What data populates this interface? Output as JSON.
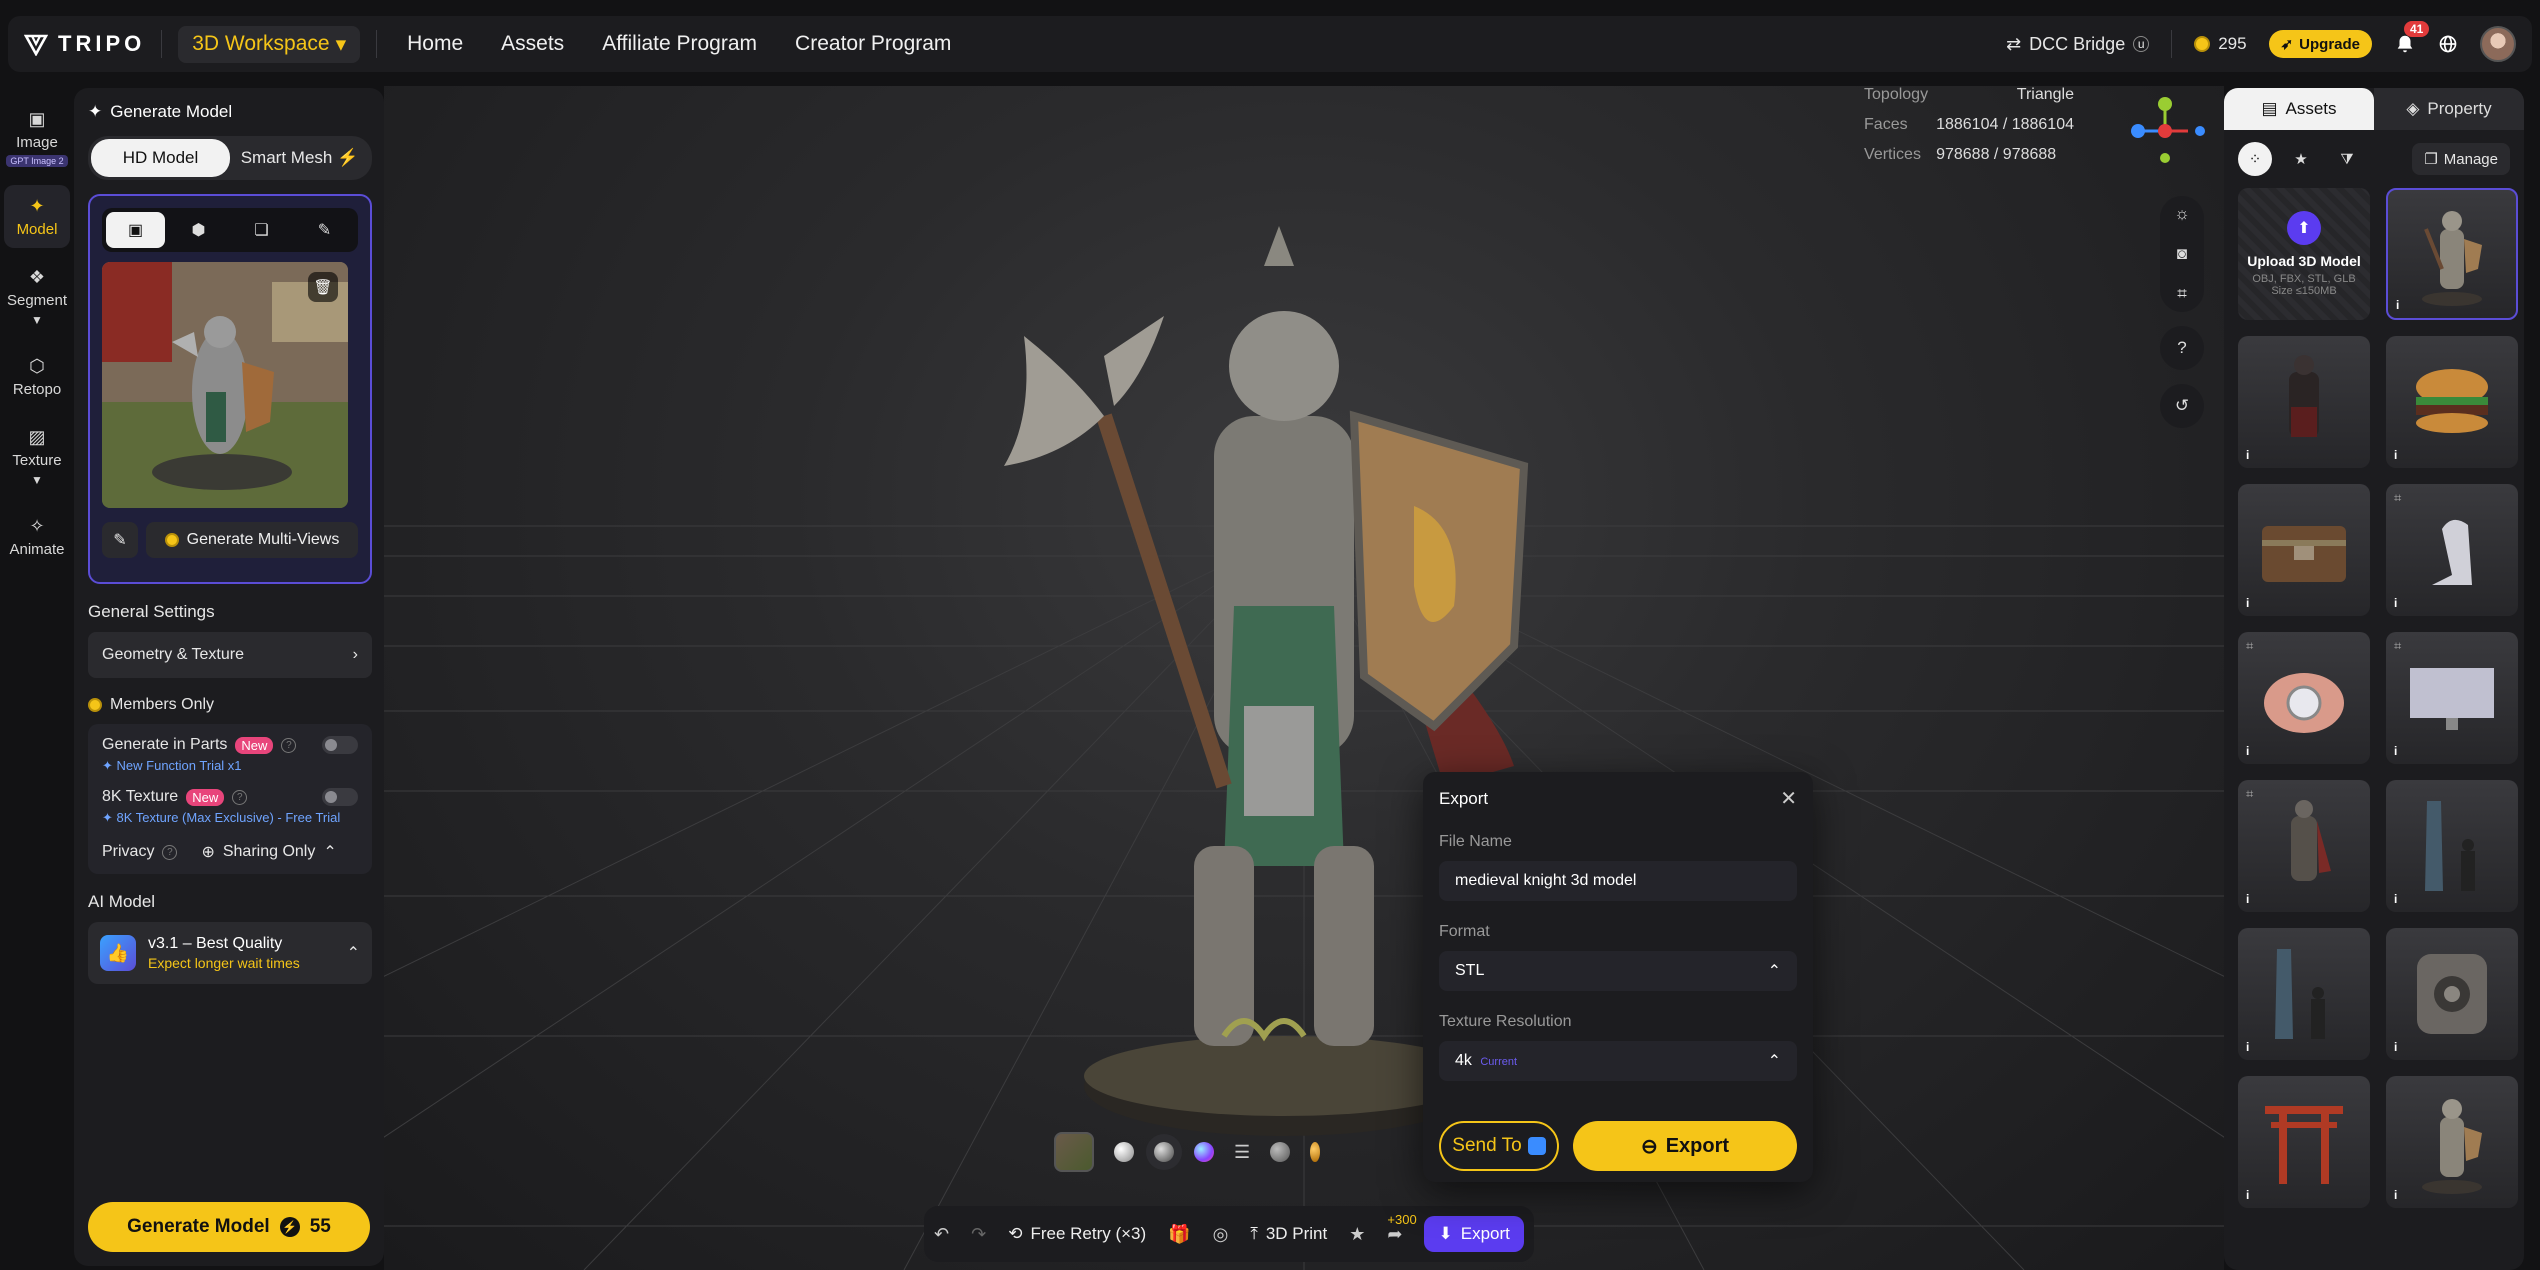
{
  "header": {
    "logo": "TRIPO",
    "workspace": "3D Workspace",
    "nav": [
      "Home",
      "Assets",
      "Affiliate Program",
      "Creator Program"
    ],
    "dcc": "DCC Bridge",
    "credits": "295",
    "upgrade": "Upgrade",
    "notifications": "41"
  },
  "rail": {
    "items": [
      {
        "label": "Image",
        "tag": "GPT Image 2"
      },
      {
        "label": "Model"
      },
      {
        "label": "Segment"
      },
      {
        "label": "Retopo"
      },
      {
        "label": "Texture"
      },
      {
        "label": "Animate"
      }
    ]
  },
  "left_panel": {
    "title": "Generate Model",
    "mode_hd": "HD Model",
    "mode_smart": "Smart Mesh",
    "generate_multiviews": "Generate Multi-Views",
    "general_settings": "General Settings",
    "geometry_texture": "Geometry & Texture",
    "members_only": "Members Only",
    "gen_parts": "Generate in Parts",
    "gen_parts_badge": "New",
    "gen_parts_sub": "New Function Trial x1",
    "tex8k": "8K Texture",
    "tex8k_badge": "New",
    "tex8k_sub": "8K Texture (Max Exclusive) - Free Trial",
    "privacy": "Privacy",
    "sharing": "Sharing Only",
    "ai_model_label": "AI Model",
    "ai_model_name": "v3.1 – Best Quality",
    "ai_model_note": "Expect longer wait times",
    "generate_btn": "Generate Model",
    "generate_cost": "55"
  },
  "viewport": {
    "topology_label": "Topology",
    "topology_value": "Triangle",
    "faces_label": "Faces",
    "faces_value": "1886104 / 1886104",
    "vertices_label": "Vertices",
    "vertices_value": "978688 / 978688"
  },
  "action_bar": {
    "free_retry": "Free Retry (×3)",
    "print": "3D Print",
    "plus": "+300",
    "export": "Export"
  },
  "export_dialog": {
    "title": "Export",
    "file_name_label": "File Name",
    "file_name_value": "medieval knight 3d model",
    "format_label": "Format",
    "format_value": "STL",
    "texture_label": "Texture Resolution",
    "texture_value": "4k",
    "texture_current": "Current",
    "send_to": "Send To",
    "export_btn": "Export"
  },
  "right_panel": {
    "tab_assets": "Assets",
    "tab_property": "Property",
    "manage": "Manage",
    "upload_title": "Upload 3D Model",
    "upload_formats": "OBJ, FBX, STL, GLB",
    "upload_size": "Size ≤150MB"
  },
  "colors": {
    "accent": "#f5c518",
    "purple": "#5b4dd6",
    "panel": "#1c1c1f"
  }
}
